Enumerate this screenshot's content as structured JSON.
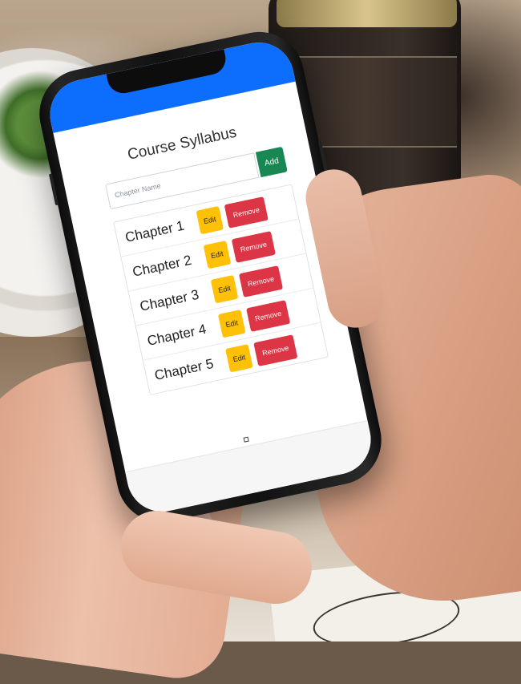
{
  "app": {
    "title": "Course Syllabus",
    "accent_color": "#0d6efd"
  },
  "form": {
    "placeholder": "Chapter Name",
    "add_label": "Add"
  },
  "chapters": [
    {
      "name": "Chapter 1",
      "edit_label": "Edit",
      "remove_label": "Remove"
    },
    {
      "name": "Chapter 2",
      "edit_label": "Edit",
      "remove_label": "Remove"
    },
    {
      "name": "Chapter 3",
      "edit_label": "Edit",
      "remove_label": "Remove"
    },
    {
      "name": "Chapter 4",
      "edit_label": "Edit",
      "remove_label": "Remove"
    },
    {
      "name": "Chapter 5",
      "edit_label": "Edit",
      "remove_label": "Remove"
    }
  ],
  "colors": {
    "add_button": "#198754",
    "edit_button": "#ffc107",
    "remove_button": "#dc3545"
  }
}
